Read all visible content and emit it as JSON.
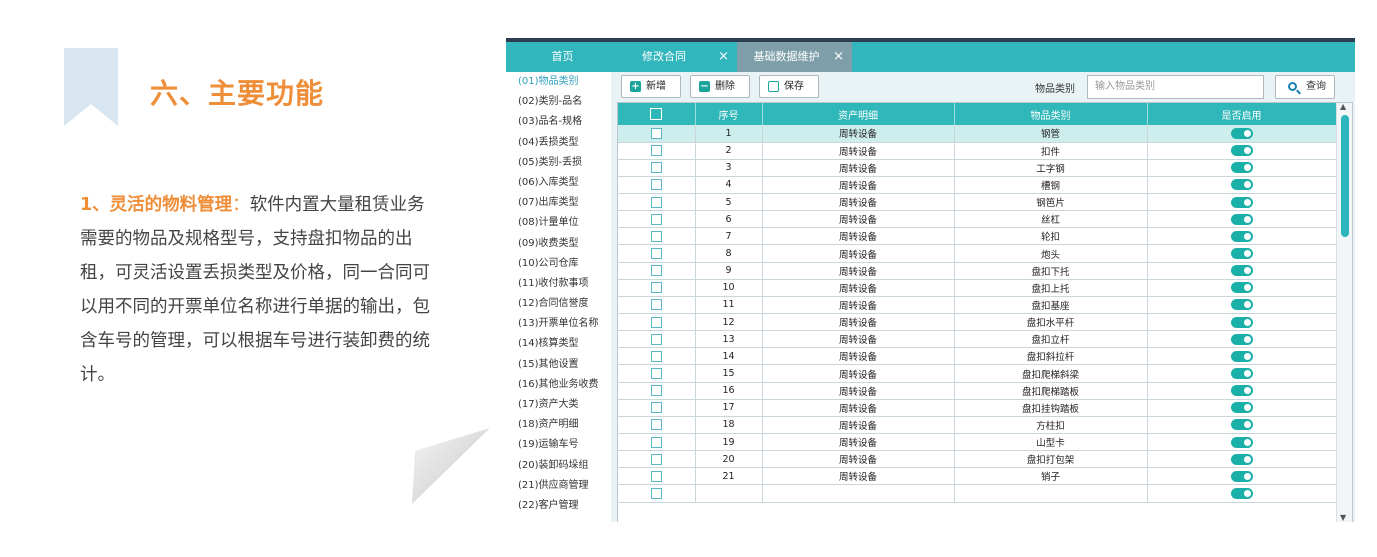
{
  "card": {
    "title": "六、主要功能",
    "highlight": "1、灵活的物料管理",
    "separator": "：",
    "body": "软件内置大量租赁业务需要的物品及规格型号，支持盘扣物品的出租，可灵活设置丢损类型及价格，同一合同可以用不同的开票单位名称进行单据的输出，包含车号的管理，可以根据车号进行装卸费的统计。"
  },
  "tabs": [
    {
      "label": "首页",
      "closable": false
    },
    {
      "label": "修改合同",
      "closable": true,
      "close": "×"
    },
    {
      "label": "基础数据维护",
      "closable": true,
      "close": "×"
    }
  ],
  "sidebar": {
    "items": [
      {
        "label": "(01)物品类别"
      },
      {
        "label": "(02)类别-品名"
      },
      {
        "label": "(03)品名-规格"
      },
      {
        "label": "(04)丢损类型"
      },
      {
        "label": "(05)类别-丢损"
      },
      {
        "label": "(06)入库类型"
      },
      {
        "label": "(07)出库类型"
      },
      {
        "label": "(08)计量单位"
      },
      {
        "label": "(09)收费类型"
      },
      {
        "label": "(10)公司仓库"
      },
      {
        "label": "(11)收付款事项"
      },
      {
        "label": "(12)合同信誉度"
      },
      {
        "label": "(13)开票单位名称"
      },
      {
        "label": "(14)核算类型"
      },
      {
        "label": "(15)其他设置"
      },
      {
        "label": "(16)其他业务收费"
      },
      {
        "label": "(17)资产大类"
      },
      {
        "label": "(18)资产明细"
      },
      {
        "label": "(19)运输车号"
      },
      {
        "label": "(20)装卸码垛组"
      },
      {
        "label": "(21)供应商管理"
      },
      {
        "label": "(22)客户管理"
      }
    ]
  },
  "toolbar": {
    "add_label": "新增",
    "delete_label": "删除",
    "save_label": "保存",
    "filter_label": "物品类别",
    "filter_placeholder": "输入物品类别",
    "query_label": "查询"
  },
  "table": {
    "columns": [
      "序号",
      "资产明细",
      "物品类别",
      "是否启用"
    ],
    "rows": [
      {
        "no": "1",
        "asset": "周转设备",
        "category": "钢管",
        "enabled": true
      },
      {
        "no": "2",
        "asset": "周转设备",
        "category": "扣件",
        "enabled": true
      },
      {
        "no": "3",
        "asset": "周转设备",
        "category": "工字钢",
        "enabled": true
      },
      {
        "no": "4",
        "asset": "周转设备",
        "category": "槽钢",
        "enabled": true
      },
      {
        "no": "5",
        "asset": "周转设备",
        "category": "钢笆片",
        "enabled": true
      },
      {
        "no": "6",
        "asset": "周转设备",
        "category": "丝杠",
        "enabled": true
      },
      {
        "no": "7",
        "asset": "周转设备",
        "category": "轮扣",
        "enabled": true
      },
      {
        "no": "8",
        "asset": "周转设备",
        "category": "炮头",
        "enabled": true
      },
      {
        "no": "9",
        "asset": "周转设备",
        "category": "盘扣下托",
        "enabled": true
      },
      {
        "no": "10",
        "asset": "周转设备",
        "category": "盘扣上托",
        "enabled": true
      },
      {
        "no": "11",
        "asset": "周转设备",
        "category": "盘扣基座",
        "enabled": true
      },
      {
        "no": "12",
        "asset": "周转设备",
        "category": "盘扣水平杆",
        "enabled": true
      },
      {
        "no": "13",
        "asset": "周转设备",
        "category": "盘扣立杆",
        "enabled": true
      },
      {
        "no": "14",
        "asset": "周转设备",
        "category": "盘扣斜拉杆",
        "enabled": true
      },
      {
        "no": "15",
        "asset": "周转设备",
        "category": "盘扣爬梯斜梁",
        "enabled": true
      },
      {
        "no": "16",
        "asset": "周转设备",
        "category": "盘扣爬梯踏板",
        "enabled": true
      },
      {
        "no": "17",
        "asset": "周转设备",
        "category": "盘扣挂钩踏板",
        "enabled": true
      },
      {
        "no": "18",
        "asset": "周转设备",
        "category": "方柱扣",
        "enabled": true
      },
      {
        "no": "19",
        "asset": "周转设备",
        "category": "山型卡",
        "enabled": true
      },
      {
        "no": "20",
        "asset": "周转设备",
        "category": "盘扣打包架",
        "enabled": true
      },
      {
        "no": "21",
        "asset": "周转设备",
        "category": "销子",
        "enabled": true
      },
      {
        "no": "",
        "asset": "",
        "category": "",
        "enabled": true
      }
    ]
  },
  "colors": {
    "accent": "#31b6bd",
    "title_orange": "#ef8e39",
    "toggle_on": "#1ab0a8",
    "selected_row": "#cdeeed"
  }
}
